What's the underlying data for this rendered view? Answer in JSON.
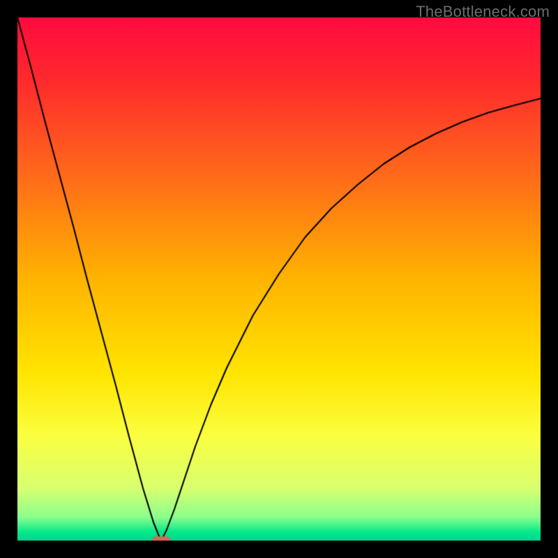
{
  "watermark": "TheBottleneck.com",
  "chart_data": {
    "type": "line",
    "title": "",
    "xlabel": "",
    "ylabel": "",
    "xlim": [
      0,
      100
    ],
    "ylim": [
      0,
      100
    ],
    "background_gradient_stops": [
      {
        "pos": 0.0,
        "color": "#ff0b3f"
      },
      {
        "pos": 0.12,
        "color": "#ff2a2d"
      },
      {
        "pos": 0.3,
        "color": "#ff6a1a"
      },
      {
        "pos": 0.5,
        "color": "#ffb400"
      },
      {
        "pos": 0.68,
        "color": "#ffe500"
      },
      {
        "pos": 0.8,
        "color": "#fbff40"
      },
      {
        "pos": 0.9,
        "color": "#d8ff70"
      },
      {
        "pos": 0.955,
        "color": "#8cff8c"
      },
      {
        "pos": 0.985,
        "color": "#00e88a"
      },
      {
        "pos": 1.0,
        "color": "#00d592"
      }
    ],
    "series": [
      {
        "name": "left-arm",
        "x": [
          0.0,
          2.7,
          5.3,
          8.0,
          10.7,
          13.3,
          16.0,
          18.7,
          21.3,
          24.0,
          26.0,
          27.0,
          27.5
        ],
        "y": [
          100.0,
          90.0,
          80.0,
          70.0,
          60.0,
          50.0,
          40.0,
          30.0,
          20.0,
          10.0,
          3.5,
          1.0,
          0.0
        ]
      },
      {
        "name": "right-arm",
        "x": [
          27.5,
          28.5,
          30.0,
          32.0,
          34.0,
          37.0,
          40.0,
          45.0,
          50.0,
          55.0,
          60.0,
          65.0,
          70.0,
          75.0,
          80.0,
          85.0,
          90.0,
          95.0,
          100.0
        ],
        "y": [
          0.0,
          2.0,
          6.0,
          12.0,
          18.0,
          26.0,
          33.0,
          43.0,
          51.0,
          58.0,
          63.5,
          68.0,
          72.0,
          75.2,
          77.8,
          80.0,
          81.8,
          83.2,
          84.5
        ]
      }
    ],
    "marker": {
      "name": "vertex-marker",
      "x": 27.5,
      "y": 0.0,
      "width_x": 3.6,
      "height_y": 1.6,
      "color": "#d66a58"
    }
  }
}
